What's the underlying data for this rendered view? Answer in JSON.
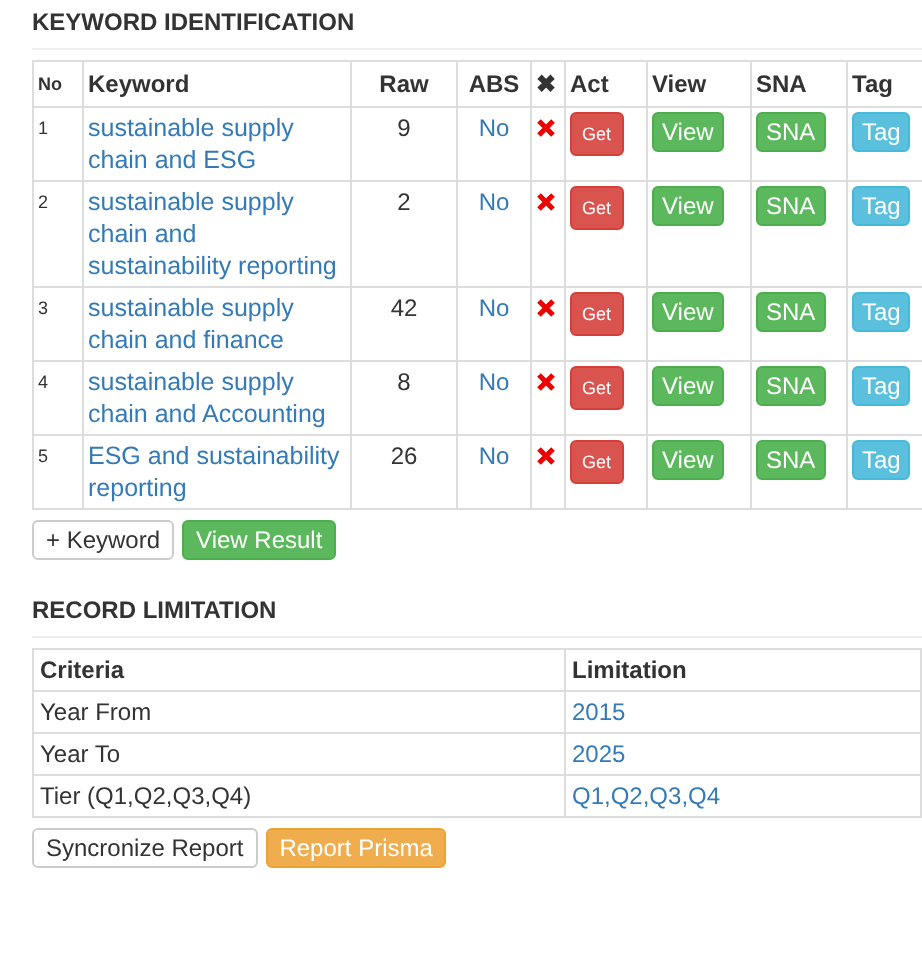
{
  "keyword_section": {
    "title": "KEYWORD IDENTIFICATION",
    "columns": [
      "No",
      "Keyword",
      "Raw",
      "ABS",
      "✖",
      "Act",
      "View",
      "SNA",
      "Tag"
    ],
    "rows": [
      {
        "no": "1",
        "keyword": "sustainable supply chain and ESG",
        "raw": "9",
        "abs": "No",
        "act": "Get",
        "view": "View",
        "sna": "SNA",
        "tag": "Tag"
      },
      {
        "no": "2",
        "keyword": "sustainable supply chain and sustainability reporting",
        "raw": "2",
        "abs": "No",
        "act": "Get",
        "view": "View",
        "sna": "SNA",
        "tag": "Tag"
      },
      {
        "no": "3",
        "keyword": "sustainable supply chain and finance",
        "raw": "42",
        "abs": "No",
        "act": "Get",
        "view": "View",
        "sna": "SNA",
        "tag": "Tag"
      },
      {
        "no": "4",
        "keyword": "sustainable supply chain and Accounting",
        "raw": "8",
        "abs": "No",
        "act": "Get",
        "view": "View",
        "sna": "SNA",
        "tag": "Tag"
      },
      {
        "no": "5",
        "keyword": "ESG and sustainability reporting",
        "raw": "26",
        "abs": "No",
        "act": "Get",
        "view": "View",
        "sna": "SNA",
        "tag": "Tag"
      }
    ],
    "buttons": [
      {
        "label": "+ Keyword",
        "kind": "default"
      },
      {
        "label": "View Result",
        "kind": "success"
      }
    ]
  },
  "record_section": {
    "title": "RECORD LIMITATION",
    "columns": [
      "Criteria",
      "Limitation"
    ],
    "rows": [
      {
        "criteria": "Year From",
        "limitation": "2015"
      },
      {
        "criteria": "Year To",
        "limitation": "2025"
      },
      {
        "criteria": "Tier (Q1,Q2,Q3,Q4)",
        "limitation": "Q1,Q2,Q3,Q4"
      }
    ],
    "buttons": [
      {
        "label": "Syncronize Report",
        "kind": "default"
      },
      {
        "label": "Report Prisma",
        "kind": "warning"
      }
    ]
  }
}
